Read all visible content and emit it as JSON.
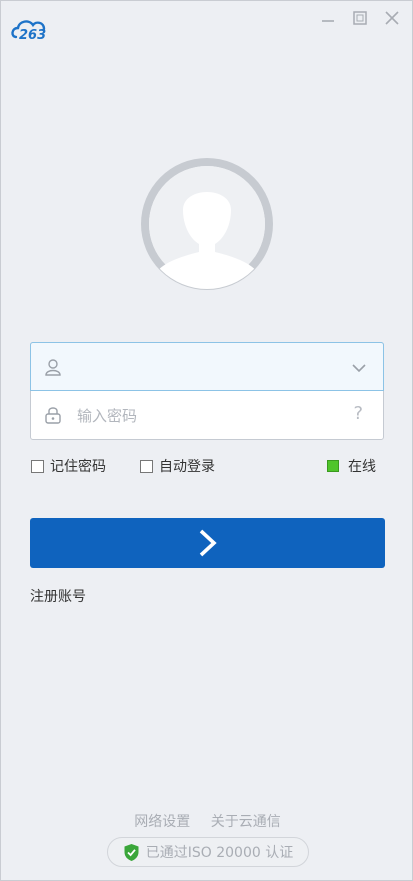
{
  "app": {
    "logo_text": "263"
  },
  "window_controls": [
    "minimize",
    "maximize",
    "close"
  ],
  "login": {
    "username_value": "",
    "password_placeholder": "输入密码",
    "help_symbol": "?"
  },
  "options": {
    "remember_password": {
      "label": "记住密码",
      "checked": false
    },
    "auto_login": {
      "label": "自动登录",
      "checked": false
    },
    "status": {
      "label": "在线",
      "color": "#4fc52a"
    }
  },
  "login_button": {
    "symbol": "›",
    "color": "#0f63be"
  },
  "register_link": "注册账号",
  "footer": {
    "network_settings": "网络设置",
    "about": "关于云通信",
    "iso_badge": "已通过ISO 20000 认证",
    "shield_color": "#3aa63a"
  }
}
